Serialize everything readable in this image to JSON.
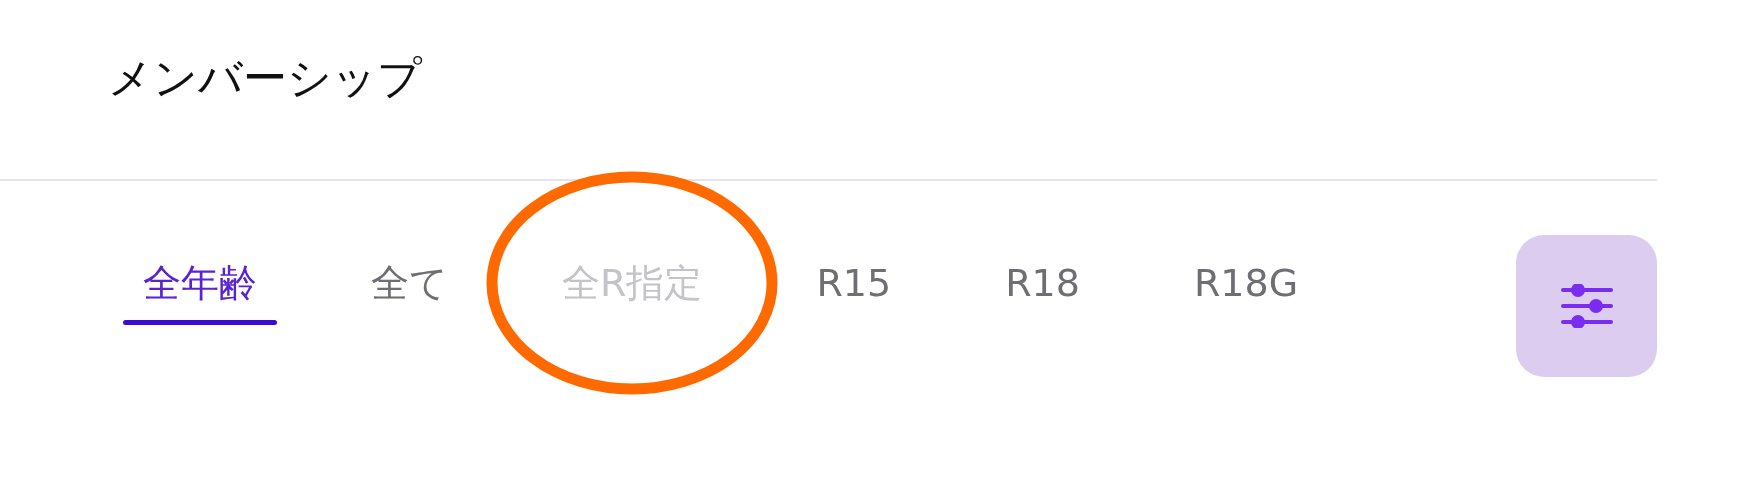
{
  "header": {
    "title": "メンバーシップ"
  },
  "tabs": [
    {
      "label": "全年齢",
      "selected": true,
      "disabled": false,
      "circled": false
    },
    {
      "label": "全て",
      "selected": false,
      "disabled": false,
      "circled": false
    },
    {
      "label": "全R指定",
      "selected": false,
      "disabled": true,
      "circled": true
    },
    {
      "label": "R15",
      "selected": false,
      "disabled": false,
      "circled": false
    },
    {
      "label": "R18",
      "selected": false,
      "disabled": false,
      "circled": false
    },
    {
      "label": "R18G",
      "selected": false,
      "disabled": false,
      "circled": false
    }
  ]
}
